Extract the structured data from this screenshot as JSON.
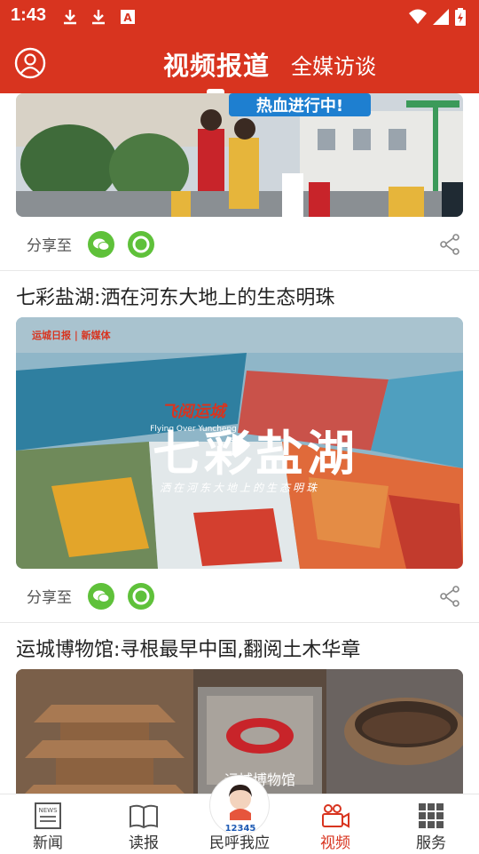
{
  "status_bar": {
    "time": "1:43",
    "icons": [
      "download-icon",
      "download-icon",
      "a-icon",
      "wifi-icon",
      "signal-icon",
      "battery-icon"
    ]
  },
  "header": {
    "tabs": [
      {
        "label": "视频报道",
        "active": true
      },
      {
        "label": "全媒访谈",
        "active": false
      }
    ]
  },
  "feed": {
    "items": [
      {
        "title": "",
        "image_text": "热血进行中!",
        "share_label": "分享至"
      },
      {
        "title": "七彩盐湖:洒在河东大地上的生态明珠",
        "image_text": {
          "brand_top": "运城日报 | 新媒体",
          "series": "飞阅运城",
          "series_en": "Flying Over Yuncheng",
          "main": "七彩盐湖",
          "sub": "洒在河东大地上的生态明珠"
        },
        "share_label": "分享至"
      },
      {
        "title": "运城博物馆:寻根最早中国,翻阅土木华章",
        "image_text": "运城博物馆"
      }
    ]
  },
  "bottom_nav": {
    "items": [
      {
        "label": "新闻",
        "icon": "newspaper-icon",
        "active": false
      },
      {
        "label": "读报",
        "icon": "book-icon",
        "active": false
      },
      {
        "label": "民呼我应",
        "icon": "hotline-avatar-icon",
        "badge": "12345",
        "active": false
      },
      {
        "label": "视频",
        "icon": "video-camera-icon",
        "active": true
      },
      {
        "label": "服务",
        "icon": "grid-icon",
        "active": false
      }
    ]
  },
  "colors": {
    "brand_red": "#d8341f",
    "share_green": "#5fc13a"
  }
}
